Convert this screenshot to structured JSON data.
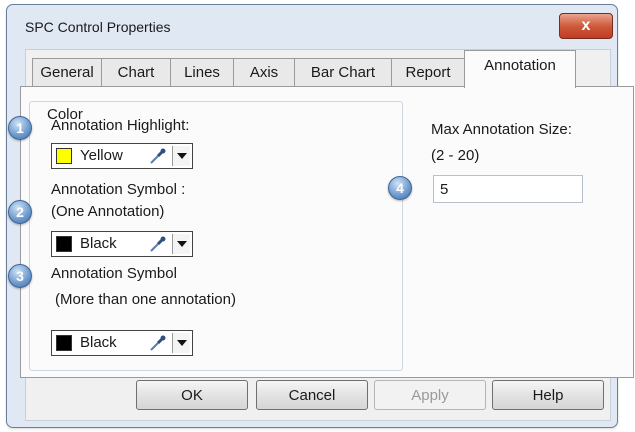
{
  "window": {
    "title": "SPC Control Properties",
    "close_glyph": "x"
  },
  "tabs": [
    {
      "label": "General"
    },
    {
      "label": "Chart"
    },
    {
      "label": "Lines"
    },
    {
      "label": "Axis"
    },
    {
      "label": "Bar Chart"
    },
    {
      "label": "Report"
    },
    {
      "label": "Annotation"
    }
  ],
  "active_tab": "Annotation",
  "color_group": {
    "legend": "Color",
    "highlight": {
      "badge": "1",
      "label": "Annotation Highlight:",
      "value": "Yellow",
      "swatch_color": "#ffff00"
    },
    "symbol_one": {
      "badge": "2",
      "label_line1": "Annotation Symbol :",
      "label_line2": "(One Annotation)",
      "value": "Black",
      "swatch_color": "#000000"
    },
    "symbol_many": {
      "badge": "3",
      "label_line1": "Annotation Symbol",
      "label_line2": "(More than one annotation)",
      "value": "Black",
      "swatch_color": "#000000"
    }
  },
  "max_size": {
    "badge": "4",
    "label": "Max Annotation Size:",
    "range": "(2 - 20)",
    "value": "5"
  },
  "buttons": {
    "ok": "OK",
    "cancel": "Cancel",
    "apply": "Apply",
    "help": "Help"
  },
  "icons": {
    "picker": "eyedropper-icon",
    "dropdown": "chevron-down-icon",
    "close": "close-icon"
  },
  "colors": {
    "badge_blue": "#4f7fb8",
    "close_red": "#c9492d",
    "panel_bg": "#fbfbfb",
    "window_bg": "#dfe8f3"
  }
}
